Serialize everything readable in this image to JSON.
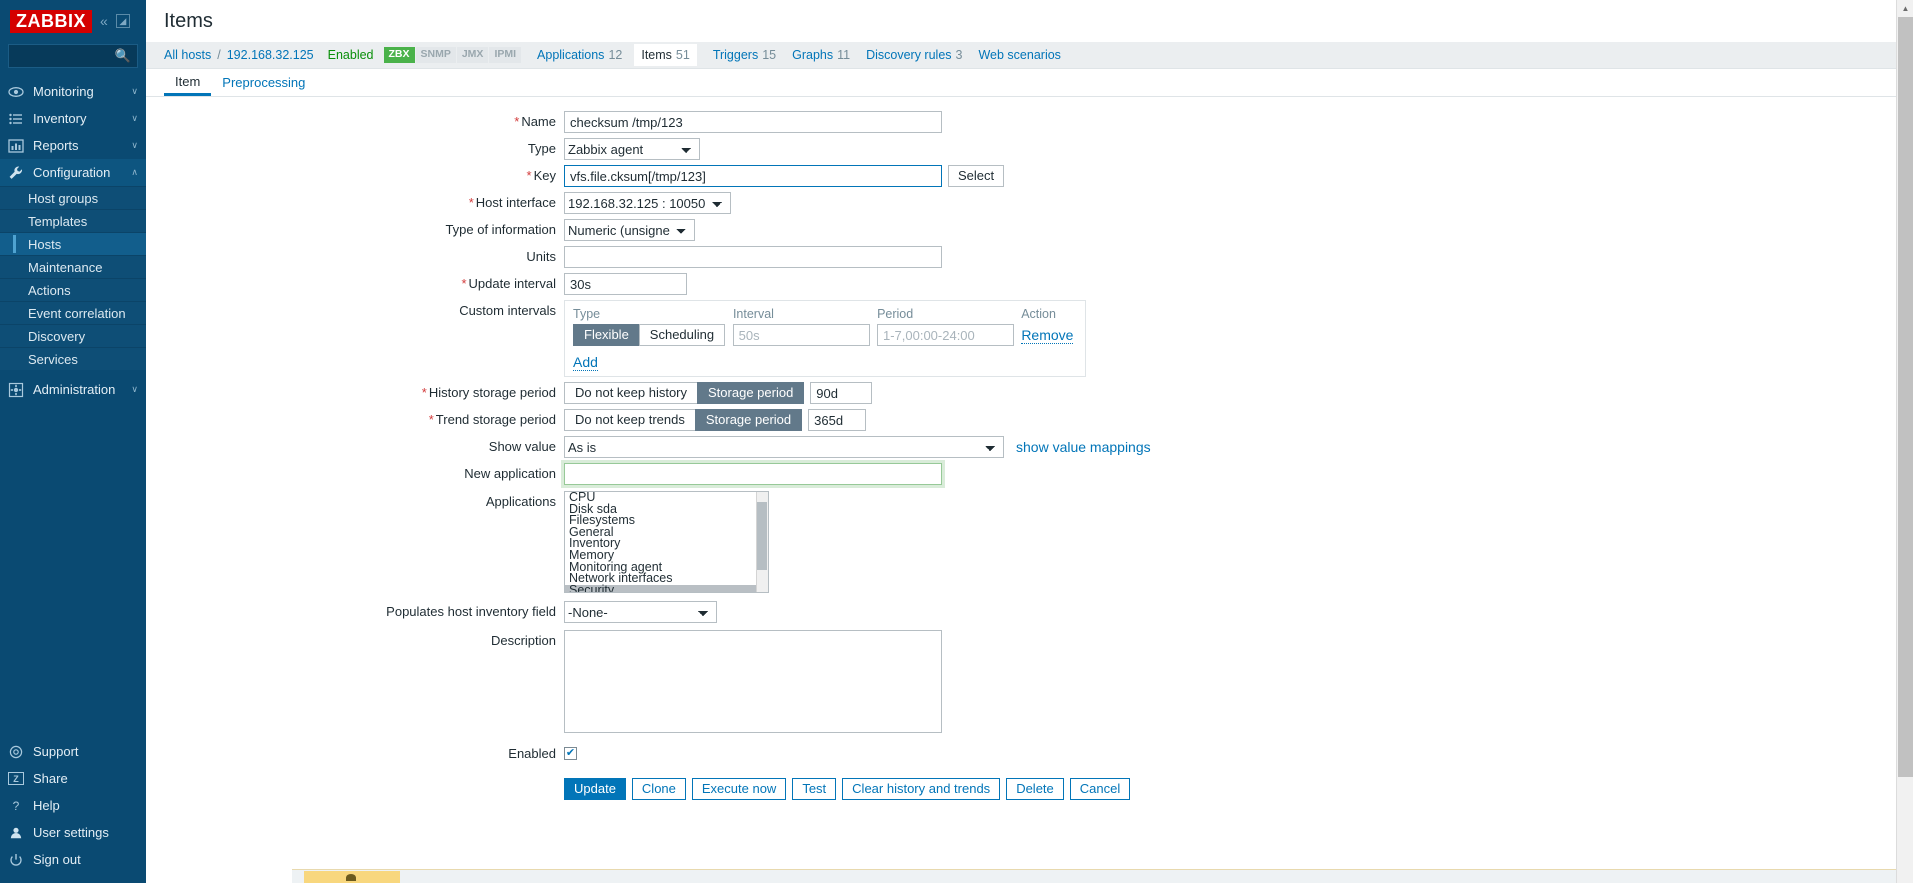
{
  "branding": {
    "logo_text": "ZABBIX"
  },
  "sidebar": {
    "collapse_icon": "chevron-double-left-icon",
    "expand_icon": "expand-panel-icon",
    "search": {
      "value": "",
      "placeholder": "",
      "icon": "search-icon"
    },
    "nav": [
      {
        "label": "Monitoring",
        "icon": "eye-icon",
        "chevron": "∨",
        "expanded": false
      },
      {
        "label": "Inventory",
        "icon": "list-icon",
        "chevron": "∨",
        "expanded": false
      },
      {
        "label": "Reports",
        "icon": "bar-chart-icon",
        "chevron": "∨",
        "expanded": false
      },
      {
        "label": "Configuration",
        "icon": "wrench-icon",
        "chevron": "∧",
        "expanded": true
      },
      {
        "label": "Administration",
        "icon": "gear-icon",
        "chevron": "∨",
        "expanded": false
      }
    ],
    "configuration_children": [
      {
        "label": "Host groups",
        "selected": false
      },
      {
        "label": "Templates",
        "selected": false
      },
      {
        "label": "Hosts",
        "selected": true
      },
      {
        "label": "Maintenance",
        "selected": false
      },
      {
        "label": "Actions",
        "selected": false
      },
      {
        "label": "Event correlation",
        "selected": false
      },
      {
        "label": "Discovery",
        "selected": false
      },
      {
        "label": "Services",
        "selected": false
      }
    ],
    "footer": [
      {
        "label": "Support",
        "icon": "lifebuoy-icon"
      },
      {
        "label": "Share",
        "icon": "share-z-icon"
      },
      {
        "label": "Help",
        "icon": "question-mark-icon"
      },
      {
        "label": "User settings",
        "icon": "user-icon"
      },
      {
        "label": "Sign out",
        "icon": "power-icon"
      }
    ]
  },
  "header": {
    "title": "Items"
  },
  "breadcrumb": {
    "all_hosts": "All hosts",
    "separator": "/",
    "host": "192.168.32.125",
    "status": "Enabled",
    "protocols": [
      {
        "label": "ZBX",
        "active": true
      },
      {
        "label": "SNMP",
        "active": false
      },
      {
        "label": "JMX",
        "active": false
      },
      {
        "label": "IPMI",
        "active": false
      }
    ],
    "tabs": [
      {
        "label": "Applications",
        "count": "12",
        "current": false
      },
      {
        "label": "Items",
        "count": "51",
        "current": true
      },
      {
        "label": "Triggers",
        "count": "15",
        "current": false
      },
      {
        "label": "Graphs",
        "count": "11",
        "current": false
      },
      {
        "label": "Discovery rules",
        "count": "3",
        "current": false
      },
      {
        "label": "Web scenarios",
        "count": "",
        "current": false
      }
    ]
  },
  "tabs": [
    {
      "label": "Item",
      "active": true
    },
    {
      "label": "Preprocessing",
      "active": false
    }
  ],
  "form": {
    "name": {
      "label": "Name",
      "required": true,
      "value": "checksum /tmp/123"
    },
    "type": {
      "label": "Type",
      "required": false,
      "value": "Zabbix agent"
    },
    "key": {
      "label": "Key",
      "required": true,
      "value": "vfs.file.cksum[/tmp/123]",
      "focused": true,
      "select_button": "Select"
    },
    "host_interface": {
      "label": "Host interface",
      "required": true,
      "value": "192.168.32.125 : 10050"
    },
    "type_of_information": {
      "label": "Type of information",
      "required": false,
      "value": "Numeric (unsigned)"
    },
    "units": {
      "label": "Units",
      "required": false,
      "value": ""
    },
    "update_interval": {
      "label": "Update interval",
      "required": true,
      "value": "30s"
    },
    "custom_intervals": {
      "label": "Custom intervals",
      "columns": [
        "Type",
        "Interval",
        "Period",
        "Action"
      ],
      "rows": [
        {
          "type_options": [
            "Flexible",
            "Scheduling"
          ],
          "type_selected": "Flexible",
          "interval_value": "",
          "interval_placeholder": "50s",
          "period_value": "",
          "period_placeholder": "1-7,00:00-24:00",
          "action": "Remove"
        }
      ],
      "add_label": "Add"
    },
    "history_storage_period": {
      "label": "History storage period",
      "required": true,
      "options": [
        "Do not keep history",
        "Storage period"
      ],
      "selected": "Storage period",
      "value": "90d"
    },
    "trend_storage_period": {
      "label": "Trend storage period",
      "required": true,
      "options": [
        "Do not keep trends",
        "Storage period"
      ],
      "selected": "Storage period",
      "value": "365d"
    },
    "show_value": {
      "label": "Show value",
      "value": "As is",
      "link": "show value mappings"
    },
    "new_application": {
      "label": "New application",
      "value": "",
      "highlighted": true
    },
    "applications": {
      "label": "Applications",
      "options": [
        {
          "label": "CPU",
          "selected": false
        },
        {
          "label": "Disk sda",
          "selected": false
        },
        {
          "label": "Filesystems",
          "selected": false
        },
        {
          "label": "General",
          "selected": false
        },
        {
          "label": "Inventory",
          "selected": false
        },
        {
          "label": "Memory",
          "selected": false
        },
        {
          "label": "Monitoring agent",
          "selected": false
        },
        {
          "label": "Network interfaces",
          "selected": false
        },
        {
          "label": "Security",
          "selected": true
        }
      ]
    },
    "populates_host_inventory_field": {
      "label": "Populates host inventory field",
      "value": "-None-"
    },
    "description": {
      "label": "Description",
      "value": ""
    },
    "enabled": {
      "label": "Enabled",
      "checked": true,
      "check_glyph": "✔"
    }
  },
  "actions": {
    "update": "Update",
    "clone": "Clone",
    "execute_now": "Execute now",
    "test": "Test",
    "clear_history": "Clear history and trends",
    "delete": "Delete",
    "cancel": "Cancel"
  },
  "colors": {
    "sidebar_bg": "#0a4a72",
    "logo_red": "#d40000",
    "link_blue": "#0275b8",
    "status_green": "#0a8f0a",
    "proto_active_green": "#4ab24a",
    "required_red": "#d23b3b",
    "segment_active": "#62798a"
  },
  "scrollbar": {
    "up_arrow": "▲",
    "down_arrow": "▼"
  }
}
